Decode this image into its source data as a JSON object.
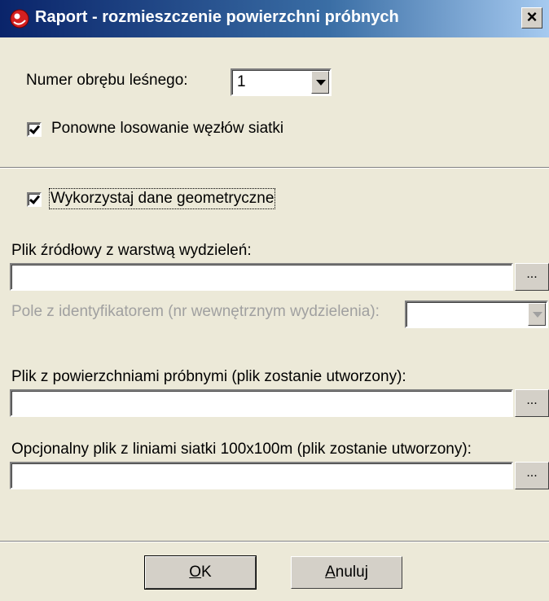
{
  "window": {
    "title": "Raport - rozmieszczenie powierzchni próbnych",
    "close_symbol": "×",
    "icon": "red-circle-app-icon"
  },
  "forest_district": {
    "label": "Numer obrębu leśnego:",
    "selected_value": "1"
  },
  "redraw_checkbox": {
    "label": "Ponowne losowanie węzłów siatki",
    "checked": true
  },
  "geometry_checkbox": {
    "label": "Wykorzystaj dane geometryczne",
    "checked": true
  },
  "source_file": {
    "label": "Plik źródłowy z warstwą wydzieleń:",
    "value": "",
    "browse_label": "..."
  },
  "id_field": {
    "label": "Pole z identyfikatorem (nr wewnętrznym wydzielenia):",
    "selected_value": "",
    "enabled": false
  },
  "sample_plots_file": {
    "label": "Plik z powierzchniami próbnymi (plik zostanie utworzony):",
    "value": "",
    "browse_label": "..."
  },
  "grid_lines_file": {
    "label": "Opcjonalny plik z liniami siatki 100x100m (plik zostanie utworzony):",
    "value": "",
    "browse_label": "..."
  },
  "buttons": {
    "ok_mnemonic": "O",
    "ok_rest": "K",
    "cancel_mnemonic": "A",
    "cancel_rest": "nuluj"
  },
  "colors": {
    "title_gradient_start": "#0a246a",
    "title_gradient_end": "#a6caf0",
    "dialog_background": "#ece9d8",
    "disabled_text": "#a0a0a0"
  }
}
